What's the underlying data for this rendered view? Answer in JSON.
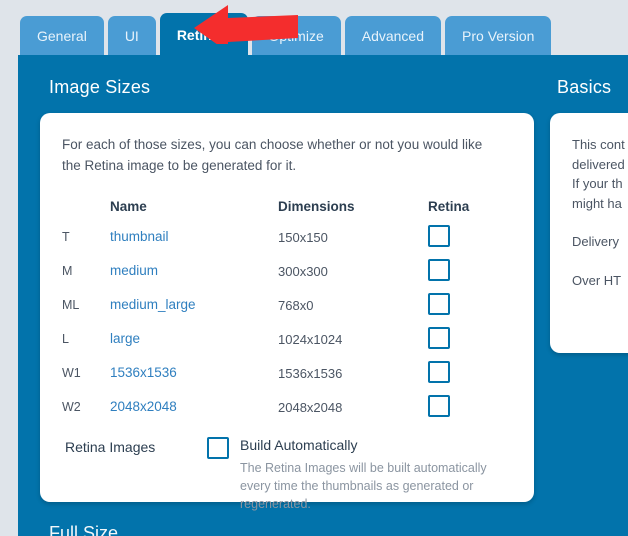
{
  "colors": {
    "page_background": "#dfe4ea",
    "panel_blue": "#0273ab",
    "tab_inactive": "#4a9cd4",
    "link_blue": "#2f7fbf",
    "arrow_red": "#f42d2d",
    "text_dark": "#2c3e50",
    "text_muted": "#8b95a1"
  },
  "tabs": [
    {
      "label": "General",
      "active": false
    },
    {
      "label": "UI",
      "active": false
    },
    {
      "label": "Retinize",
      "active": true
    },
    {
      "label": "Optimize",
      "active": false
    },
    {
      "label": "Advanced",
      "active": false
    },
    {
      "label": "Pro Version",
      "active": false
    }
  ],
  "sections": {
    "left_title": "Image Sizes",
    "right_title": "Basics",
    "bottom_title": "Full Size"
  },
  "main_card": {
    "intro": "For each of those sizes, you can choose whether or not you would like the Retina image to be generated for it.",
    "columns": {
      "key": "",
      "name": "Name",
      "dimensions": "Dimensions",
      "retina": "Retina"
    },
    "rows": [
      {
        "key": "T",
        "name": "thumbnail",
        "dimensions": "150x150",
        "retina_checked": false
      },
      {
        "key": "M",
        "name": "medium",
        "dimensions": "300x300",
        "retina_checked": false
      },
      {
        "key": "ML",
        "name": "medium_large",
        "dimensions": "768x0",
        "retina_checked": false
      },
      {
        "key": "L",
        "name": "large",
        "dimensions": "1024x1024",
        "retina_checked": false
      },
      {
        "key": "W1",
        "name": "1536x1536",
        "dimensions": "1536x1536",
        "retina_checked": false
      },
      {
        "key": "W2",
        "name": "2048x2048",
        "dimensions": "2048x2048",
        "retina_checked": false
      }
    ],
    "retina_images": {
      "label": "Retina Images",
      "option_label": "Build Automatically",
      "option_checked": false,
      "description": "The Retina Images will be built automatically every time the thumbnails as generated or regenerated."
    }
  },
  "side_card": {
    "line1": "This cont",
    "line2": "delivered",
    "line3": "If your th",
    "line4": "might ha",
    "line5": "Delivery",
    "line6": "Over HT"
  },
  "annotation": {
    "arrow_name": "red-arrow-pointing-left",
    "points_to": "Retinize"
  }
}
